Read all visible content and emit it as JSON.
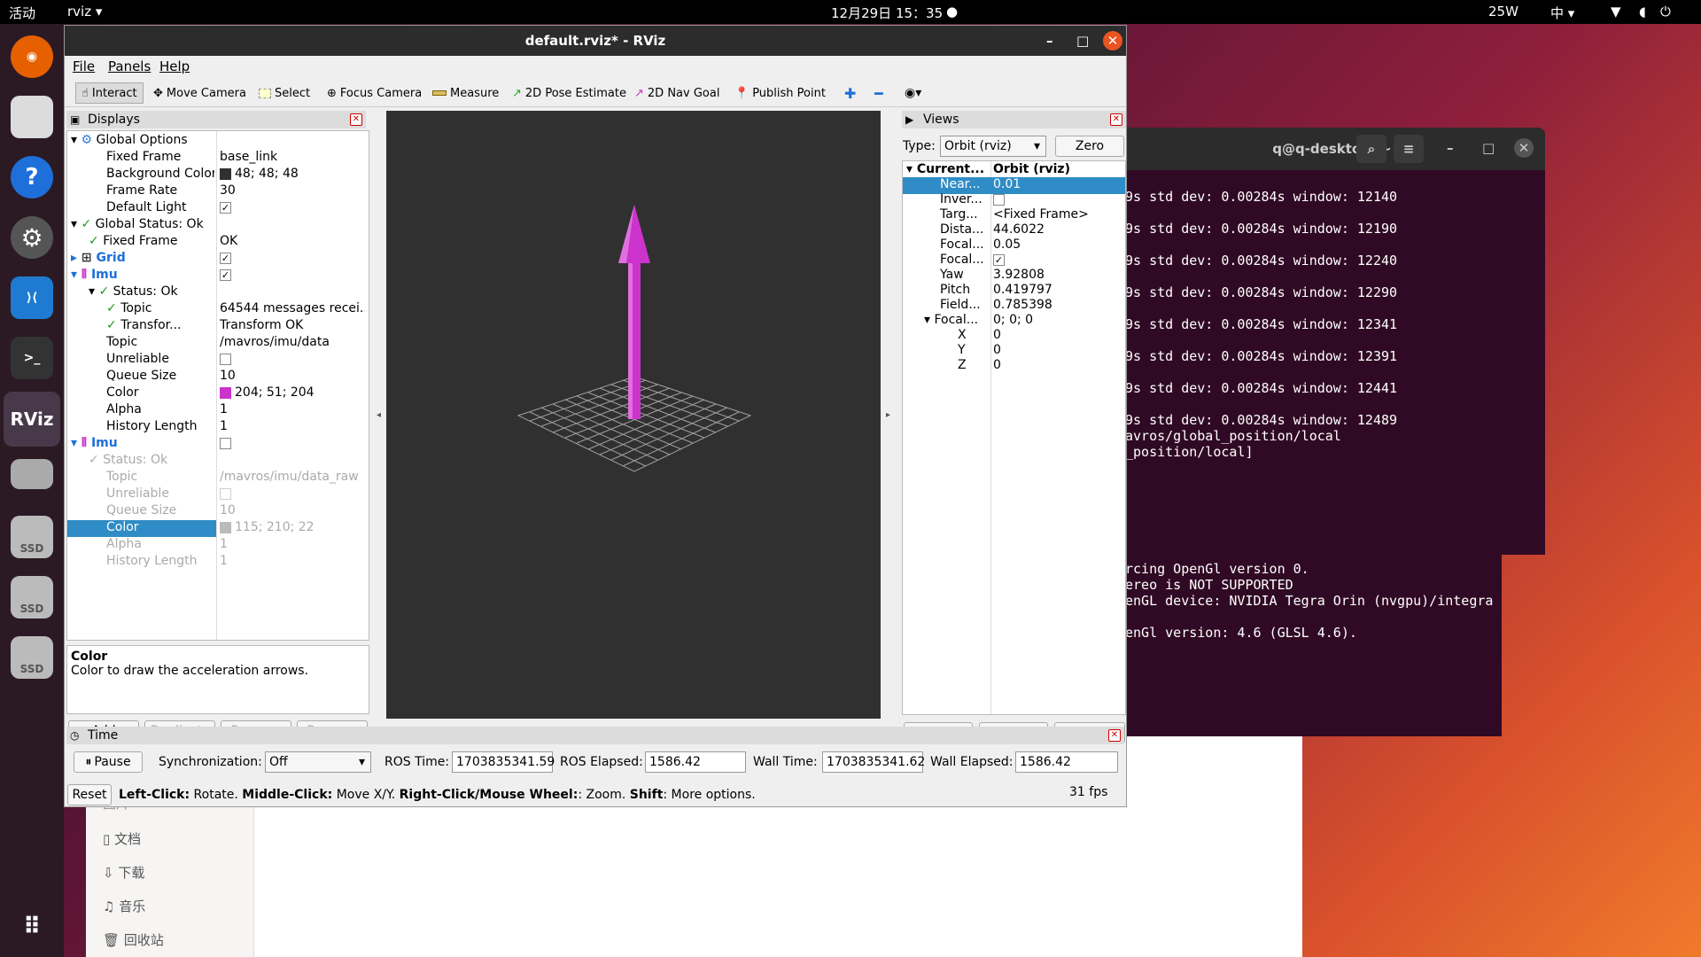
{
  "topbar": {
    "activities": "活动",
    "app": "rviz ▾",
    "clock": "12月29日  15：35",
    "power": "25W",
    "ime": "中 ▾"
  },
  "dock": {
    "rviz_label": "RViz",
    "ssd": "SSD"
  },
  "terminal": {
    "title": "q@q-desktop: ~",
    "lines": [
      "9s std dev: 0.00284s window: 12140",
      "9s std dev: 0.00284s window: 12190",
      "9s std dev: 0.00284s window: 12240",
      "9s std dev: 0.00284s window: 12290",
      "9s std dev: 0.00284s window: 12341",
      "9s std dev: 0.00284s window: 12391",
      "9s std dev: 0.00284s window: 12441",
      "9s std dev: 0.00284s window: 12489",
      "avros/global_position/local",
      "_position/local]"
    ],
    "lines2": [
      "rcing OpenGl version 0.",
      "ereo is NOT SUPPORTED",
      "enGL device: NVIDIA Tegra Orin (nvgpu)/integra",
      "",
      "enGl version: 4.6 (GLSL 4.6)."
    ]
  },
  "files": {
    "items": [
      "文档",
      "下载",
      "音乐",
      "回收站"
    ],
    "partial": "图片"
  },
  "rviz": {
    "title": "default.rviz* - RViz",
    "menu": [
      "File",
      "Panels",
      "Help"
    ],
    "tools": [
      "Interact",
      "Move Camera",
      "Select",
      "Focus Camera",
      "Measure",
      "2D Pose Estimate",
      "2D Nav Goal",
      "Publish Point"
    ],
    "displays": {
      "header": "Displays",
      "rows": [
        {
          "name": "Global Options",
          "value": ""
        },
        {
          "name": "Fixed Frame",
          "value": "base_link"
        },
        {
          "name": "Background Color",
          "value": "48; 48; 48"
        },
        {
          "name": "Frame Rate",
          "value": "30"
        },
        {
          "name": "Default Light",
          "value": "✓"
        },
        {
          "name": "Global Status: Ok",
          "value": ""
        },
        {
          "name": "Fixed Frame",
          "value": "OK"
        },
        {
          "name": "Grid",
          "value": "✓"
        },
        {
          "name": "Imu",
          "value": "✓"
        },
        {
          "name": "Status: Ok",
          "value": ""
        },
        {
          "name": "Topic",
          "value": "64544 messages recei..."
        },
        {
          "name": "Transfor...",
          "value": "Transform OK"
        },
        {
          "name": "Topic",
          "value": "/mavros/imu/data"
        },
        {
          "name": "Unreliable",
          "value": ""
        },
        {
          "name": "Queue Size",
          "value": "10"
        },
        {
          "name": "Color",
          "value": "204; 51; 204"
        },
        {
          "name": "Alpha",
          "value": "1"
        },
        {
          "name": "History Length",
          "value": "1"
        },
        {
          "name": "Imu",
          "value": ""
        },
        {
          "name": "Status: Ok",
          "value": ""
        },
        {
          "name": "Topic",
          "value": "/mavros/imu/data_raw"
        },
        {
          "name": "Unreliable",
          "value": ""
        },
        {
          "name": "Queue Size",
          "value": "10"
        },
        {
          "name": "Color",
          "value": "115; 210; 22"
        },
        {
          "name": "Alpha",
          "value": "1"
        },
        {
          "name": "History Length",
          "value": "1"
        }
      ],
      "desc_title": "Color",
      "desc_text": "Color to draw the acceleration arrows.",
      "buttons": [
        "Add",
        "Duplicate",
        "Remove",
        "Rename"
      ]
    },
    "views": {
      "header": "Views",
      "type_label": "Type:",
      "type_value": "Orbit (rviz)",
      "zero": "Zero",
      "rows": [
        {
          "name": "Current...",
          "value": "Orbit (rviz)"
        },
        {
          "name": "Near...",
          "value": "0.01"
        },
        {
          "name": "Inver...",
          "value": ""
        },
        {
          "name": "Targ...",
          "value": "<Fixed Frame>"
        },
        {
          "name": "Dista...",
          "value": "44.6022"
        },
        {
          "name": "Focal...",
          "value": "0.05"
        },
        {
          "name": "Focal...",
          "value": "✓"
        },
        {
          "name": "Yaw",
          "value": "3.92808"
        },
        {
          "name": "Pitch",
          "value": "0.419797"
        },
        {
          "name": "Field...",
          "value": "0.785398"
        },
        {
          "name": "Focal...",
          "value": "0; 0; 0"
        },
        {
          "name": "X",
          "value": "0"
        },
        {
          "name": "Y",
          "value": "0"
        },
        {
          "name": "Z",
          "value": "0"
        }
      ],
      "buttons": [
        "Save",
        "Remove",
        "Rename"
      ]
    },
    "time": {
      "header": "Time",
      "pause": "Pause",
      "sync_label": "Synchronization:",
      "sync_value": "Off",
      "ros_time_label": "ROS Time:",
      "ros_time": "1703835341.59",
      "ros_elapsed_label": "ROS Elapsed:",
      "ros_elapsed": "1586.42",
      "wall_time_label": "Wall Time:",
      "wall_time": "1703835341.62",
      "wall_elapsed_label": "Wall Elapsed:",
      "wall_elapsed": "1586.42"
    },
    "status": {
      "reset": "Reset",
      "fps": "31 fps",
      "h1": "Left-Click:",
      "t1": " Rotate. ",
      "h2": "Middle-Click:",
      "t2": " Move X/Y. ",
      "h3": "Right-Click/Mouse Wheel:",
      "t3": ": Zoom. ",
      "h4": "Shift",
      "t4": ": More options."
    },
    "colors": {
      "background": "#303030",
      "arrow": "#cc33cc",
      "imu_raw": "#73d216",
      "selection": "#308cc6"
    }
  }
}
